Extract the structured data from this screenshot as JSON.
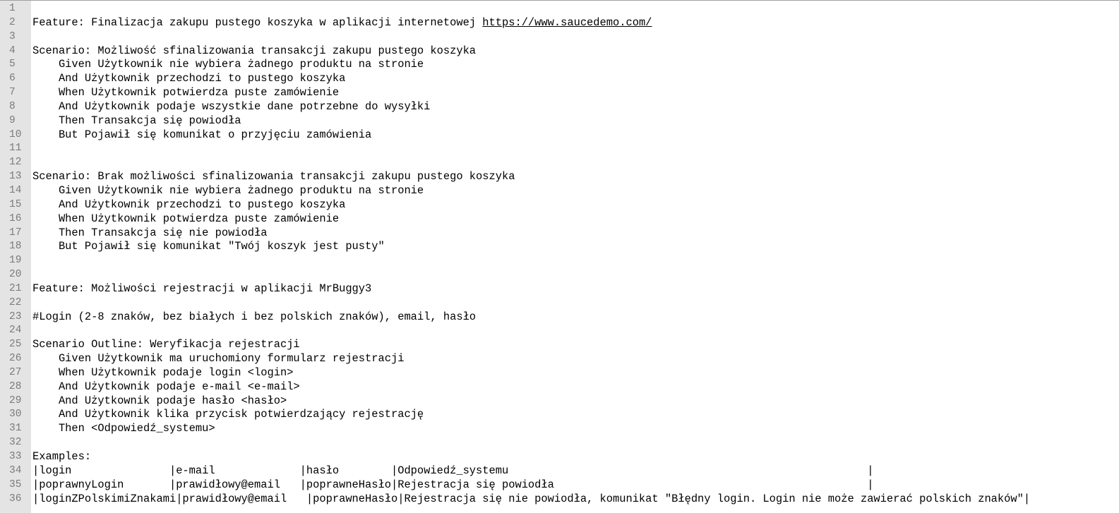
{
  "editor": {
    "lines": [
      {
        "num": "1",
        "text": ""
      },
      {
        "num": "2",
        "text": "Feature: Finalizacja zakupu pustego koszyka w aplikacji internetowej ",
        "link": "https://www.saucedemo.com/"
      },
      {
        "num": "3",
        "text": ""
      },
      {
        "num": "4",
        "text": "Scenario: Możliwość sfinalizowania transakcji zakupu pustego koszyka"
      },
      {
        "num": "5",
        "text": "    Given Użytkownik nie wybiera żadnego produktu na stronie"
      },
      {
        "num": "6",
        "text": "    And Użytkownik przechodzi to pustego koszyka"
      },
      {
        "num": "7",
        "text": "    When Użytkownik potwierdza puste zamówienie"
      },
      {
        "num": "8",
        "text": "    And Użytkownik podaje wszystkie dane potrzebne do wysyłki"
      },
      {
        "num": "9",
        "text": "    Then Transakcja się powiodła"
      },
      {
        "num": "10",
        "text": "    But Pojawił się komunikat o przyjęciu zamówienia"
      },
      {
        "num": "11",
        "text": ""
      },
      {
        "num": "12",
        "text": ""
      },
      {
        "num": "13",
        "text": "Scenario: Brak możliwości sfinalizowania transakcji zakupu pustego koszyka"
      },
      {
        "num": "14",
        "text": "    Given Użytkownik nie wybiera żadnego produktu na stronie"
      },
      {
        "num": "15",
        "text": "    And Użytkownik przechodzi to pustego koszyka"
      },
      {
        "num": "16",
        "text": "    When Użytkownik potwierdza puste zamówienie"
      },
      {
        "num": "17",
        "text": "    Then Transakcja się nie powiodła"
      },
      {
        "num": "18",
        "text": "    But Pojawił się komunikat \"Twój koszyk jest pusty\""
      },
      {
        "num": "19",
        "text": ""
      },
      {
        "num": "20",
        "text": ""
      },
      {
        "num": "21",
        "text": "Feature: Możliwości rejestracji w aplikacji MrBuggy3"
      },
      {
        "num": "22",
        "text": ""
      },
      {
        "num": "23",
        "text": "#Login (2-8 znaków, bez białych i bez polskich znaków), email, hasło"
      },
      {
        "num": "24",
        "text": ""
      },
      {
        "num": "25",
        "text": "Scenario Outline: Weryfikacja rejestracji"
      },
      {
        "num": "26",
        "text": "    Given Użytkownik ma uruchomiony formularz rejestracji"
      },
      {
        "num": "27",
        "text": "    When Użytkownik podaje login <login>"
      },
      {
        "num": "28",
        "text": "    And Użytkownik podaje e-mail <e-mail>"
      },
      {
        "num": "29",
        "text": "    And Użytkownik podaje hasło <hasło>"
      },
      {
        "num": "30",
        "text": "    And Użytkownik klika przycisk potwierdzający rejestrację"
      },
      {
        "num": "31",
        "text": "    Then <Odpowiedź_systemu>"
      },
      {
        "num": "32",
        "text": ""
      },
      {
        "num": "33",
        "text": "Examples:"
      },
      {
        "num": "34",
        "text": "|login               |e-mail             |hasło        |Odpowiedź_systemu                                                       |"
      },
      {
        "num": "35",
        "text": "|poprawnyLogin       |prawidłowy@email   |poprawneHasło|Rejestracja się powiodła                                                |"
      },
      {
        "num": "36",
        "text": "|loginZPolskimiZnakami|prawidłowy@email   |poprawneHasło|Rejestracja się nie powiodła, komunikat \"Błędny login. Login nie może zawierać polskich znaków\"|"
      }
    ]
  }
}
